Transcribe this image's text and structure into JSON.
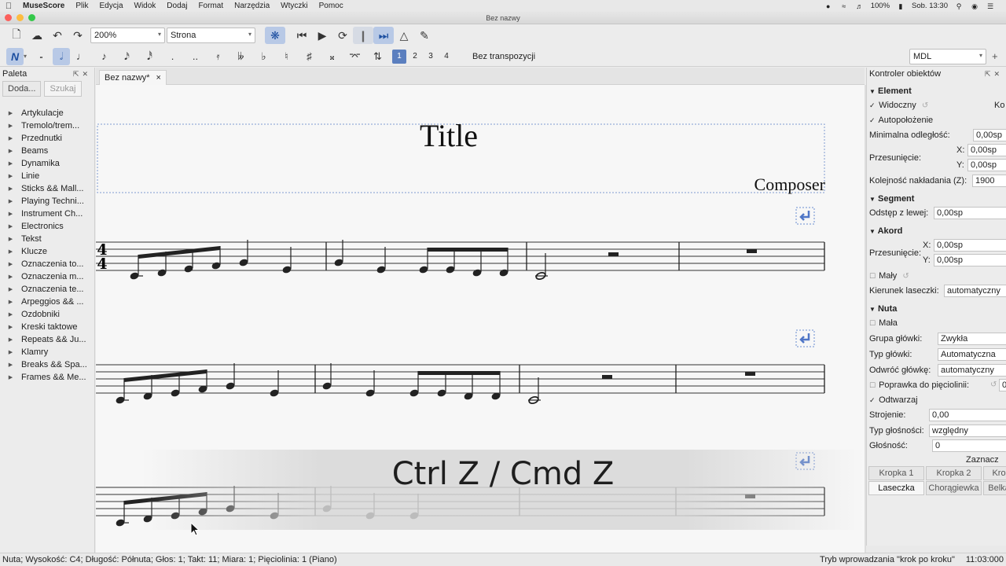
{
  "menubar": {
    "app": "MuseScore",
    "items": [
      "Plik",
      "Edycja",
      "Widok",
      "Dodaj",
      "Format",
      "Narzędzia",
      "Wtyczki",
      "Pomoc"
    ],
    "battery": "100%",
    "datetime": "Sob. 13:30"
  },
  "window": {
    "title": "Bez nazwy"
  },
  "toolbar": {
    "zoom": "200%",
    "view_mode": "Strona",
    "voices": [
      "1",
      "2",
      "3",
      "4"
    ],
    "transposition": "Bez transpozycji",
    "workspace": "MDL"
  },
  "palette": {
    "title": "Paleta",
    "add_button": "Doda...",
    "search_placeholder": "Szukaj",
    "items": [
      "Artykulacje",
      "Tremolo/trem...",
      "Przednutki",
      "Beams",
      "Dynamika",
      "Linie",
      "Sticks && Mall...",
      "Playing Techni...",
      "Instrument Ch...",
      "Electronics",
      "Tekst",
      "Klucze",
      "Oznaczenia to...",
      "Oznaczenia m...",
      "Oznaczenia te...",
      "Arpeggios && ...",
      "Ozdobniki",
      "Kreski taktowe",
      "Repeats && Ju...",
      "Klamry",
      "Breaks && Spa...",
      "Frames && Me..."
    ]
  },
  "tab": {
    "label": "Bez nazwy*",
    "close": "×"
  },
  "score": {
    "title": "Title",
    "composer": "Composer",
    "time_signature": {
      "top": "4",
      "bottom": "4"
    }
  },
  "overlay": {
    "text": "Ctrl Z / Cmd Z"
  },
  "inspector": {
    "title": "Kontroler obiektów",
    "element": {
      "heading": "Element",
      "visible": "Widoczny",
      "visible_cut": "Ko",
      "autoplace": "Autopołożenie",
      "min_distance_label": "Minimalna odległość:",
      "min_distance": "0,00sp",
      "offset_label": "Przesunięcie:",
      "offset_x": "0,00sp",
      "offset_y": "0,00sp",
      "z_label": "Kolejność nakładania (Z):",
      "z_value": "1900"
    },
    "segment": {
      "heading": "Segment",
      "leading_label": "Odstęp z lewej:",
      "leading": "0,00sp"
    },
    "chord": {
      "heading": "Akord",
      "offset_label": "Przesunięcie:",
      "offset_x": "0,00sp",
      "offset_y": "0,00sp",
      "small": "Mały",
      "stem_label": "Kierunek laseczki:",
      "stem": "automatyczny"
    },
    "note": {
      "heading": "Nuta",
      "small": "Mała",
      "head_group_label": "Grupa główki:",
      "head_group": "Zwykła",
      "head_type_label": "Typ główki:",
      "head_type": "Automatyczna",
      "mirror_label": "Odwróć główkę:",
      "mirror": "automatyczny",
      "fix_label": "Poprawka do pięciolinii:",
      "fix": "0",
      "play": "Odtwarzaj",
      "tuning_label": "Strojenie:",
      "tuning": "0,00",
      "velocity_type_label": "Typ głośności:",
      "velocity_type": "względny",
      "velocity_label": "Głośność:",
      "velocity": "0",
      "select_label": "Zaznacz",
      "dot1": "Kropka 1",
      "dot2": "Kropka 2",
      "dot3": "Kro",
      "stem_btn": "Laseczka",
      "hook_btn": "Chorągiewka",
      "beam_btn": "Belka"
    }
  },
  "status": {
    "left": "Nuta; Wysokość: C4; Długość: Półnuta; Głos: 1;  Takt: 11; Miara: 1; Pięciolinia: 1 (Piano)",
    "mode": "Tryb wprowadzania \"krok po kroku\"",
    "time": "11:03:000"
  }
}
